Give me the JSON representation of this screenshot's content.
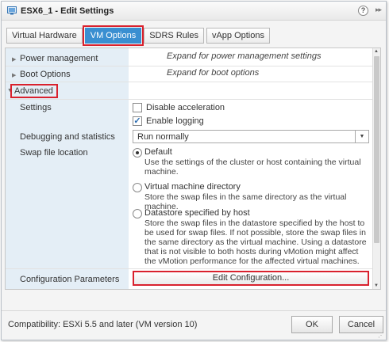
{
  "window": {
    "title": "ESX6_1 - Edit Settings",
    "help_glyph": "?",
    "expand_glyph": "▸▸"
  },
  "tabs": [
    {
      "label": "Virtual Hardware",
      "active": false
    },
    {
      "label": "VM Options",
      "active": true
    },
    {
      "label": "SDRS Rules",
      "active": false
    },
    {
      "label": "vApp Options",
      "active": false
    }
  ],
  "sections": {
    "power_management": {
      "label": "Power management",
      "hint": "Expand for power management settings"
    },
    "boot_options": {
      "label": "Boot Options",
      "hint": "Expand for boot options"
    },
    "advanced": {
      "label": "Advanced"
    }
  },
  "settings": {
    "label": "Settings",
    "disable_acceleration": {
      "label": "Disable acceleration",
      "checked": false
    },
    "enable_logging": {
      "label": "Enable logging",
      "checked": true,
      "glyph": "✓"
    }
  },
  "debugging": {
    "label": "Debugging and statistics",
    "value": "Run normally"
  },
  "swap": {
    "label": "Swap file location",
    "options": [
      {
        "label": "Default",
        "selected": true,
        "description": "Use the settings of the cluster or host containing the virtual machine."
      },
      {
        "label": "Virtual machine directory",
        "selected": false,
        "description": "Store the swap files in the same directory as the virtual machine."
      },
      {
        "label": "Datastore specified by host",
        "selected": false,
        "description": "Store the swap files in the datastore specified by the host to be used for swap files. If not possible, store the swap files in the same directory as the virtual machine. Using a datastore that is not visible to both hosts during vMotion might affect the vMotion performance for the affected virtual machines."
      }
    ]
  },
  "configuration": {
    "label": "Configuration Parameters",
    "button_label": "Edit Configuration..."
  },
  "footer": {
    "compatibility": "Compatibility: ESXi 5.5 and later (VM version 10)",
    "ok_label": "OK",
    "cancel_label": "Cancel"
  },
  "colors": {
    "accent": "#3a8fd1",
    "highlight": "#d9212d",
    "label_column": "#e4eef6"
  }
}
